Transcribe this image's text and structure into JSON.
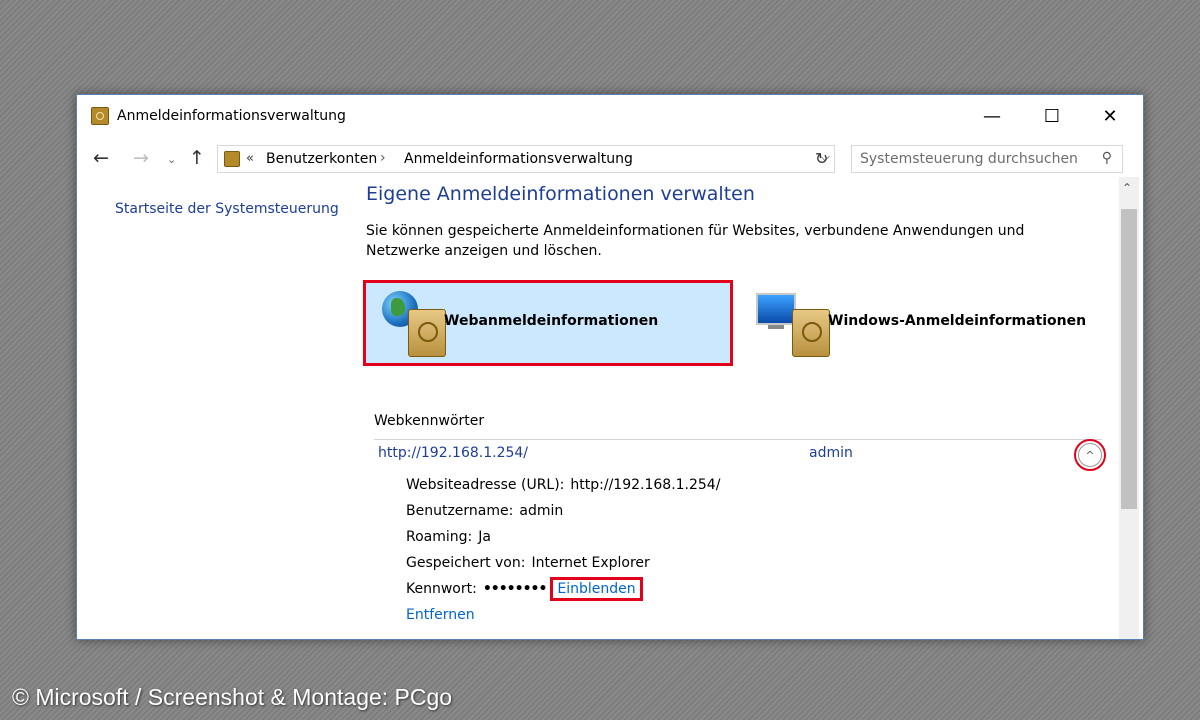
{
  "window": {
    "title": "Anmeldeinformationsverwaltung",
    "controls": {
      "minimize": "—",
      "maximize": "☐",
      "close": "✕"
    }
  },
  "address": {
    "overflow": "«",
    "crumbs": [
      "Benutzerkonten",
      "Anmeldeinformationsverwaltung"
    ],
    "separator": "›",
    "dropdown": "⌵",
    "refresh": "↻"
  },
  "search": {
    "placeholder": "Systemsteuerung durchsuchen",
    "icon": "⚲"
  },
  "nav": {
    "back": "←",
    "forward": "→",
    "recent": "⌄",
    "up": "↑"
  },
  "sidebar": {
    "home_link": "Startseite der Systemsteuerung"
  },
  "main": {
    "heading": "Eigene Anmeldeinformationen verwalten",
    "description": "Sie können gespeicherte Anmeldeinformationen für Websites, verbundene Anwendungen und Netzwerke anzeigen und löschen.",
    "tiles": [
      {
        "label": "Webanmeldeinformationen",
        "icon": "globe-safe-icon",
        "selected": true
      },
      {
        "label": "Windows-Anmeldeinformationen",
        "icon": "monitor-safe-icon",
        "selected": false
      }
    ],
    "section_title": "Webkennwörter",
    "entry": {
      "url": "http://192.168.1.254/",
      "user": "admin",
      "collapse_icon": "^",
      "details": [
        {
          "key": "Websiteadresse (URL):",
          "value": "http://192.168.1.254/"
        },
        {
          "key": "Benutzername:",
          "value": "admin"
        },
        {
          "key": "Roaming:",
          "value": "Ja"
        },
        {
          "key": "Gespeichert von:",
          "value": "Internet Explorer"
        }
      ],
      "password_key": "Kennwort:",
      "password_mask": "••••••••",
      "show_link": "Einblenden",
      "remove_link": "Entfernen"
    }
  },
  "scrollbar": {
    "up": "⌃"
  },
  "watermark": "© Microsoft / Screenshot & Montage: PCgo",
  "colors": {
    "highlight": "#e2001a",
    "link": "#1e3e96",
    "accent_link": "#0066cc",
    "tile_selected": "#cce8ff"
  }
}
